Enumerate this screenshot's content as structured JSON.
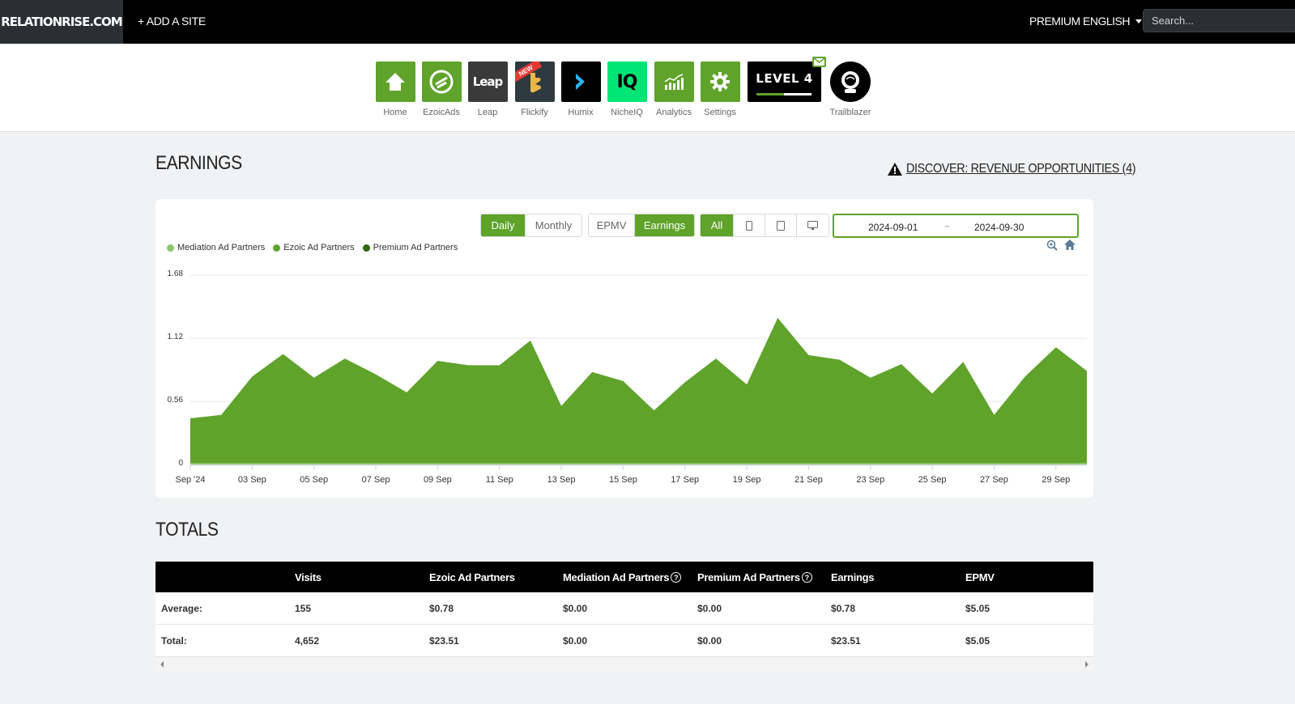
{
  "topbar": {
    "brand": "RELATIONRISE.COM",
    "add_site": "+ ADD A SITE",
    "premium": "PREMIUM",
    "language": "ENGLISH",
    "search_placeholder": "Search..."
  },
  "apps": [
    {
      "label": "Home",
      "icon": "home-icon",
      "color": "#5fa32b"
    },
    {
      "label": "EzoicAds",
      "icon": "ezoic-ads-icon",
      "color": "#5fa32b"
    },
    {
      "label": "Leap",
      "icon": "leap-icon",
      "color": "#3a3a3a",
      "tile_text": "Leap"
    },
    {
      "label": "Flickify",
      "icon": "flickify-icon",
      "color": "#2f3a40",
      "badge": "NEW"
    },
    {
      "label": "Humix",
      "icon": "humix-icon",
      "color": "#000000"
    },
    {
      "label": "NicheIQ",
      "icon": "nicheiq-icon",
      "color": "#00e676",
      "tile_text": "IQ"
    },
    {
      "label": "Analytics",
      "icon": "analytics-icon",
      "color": "#5fa32b"
    },
    {
      "label": "Settings",
      "icon": "gear-icon",
      "color": "#5fa32b"
    }
  ],
  "level": {
    "label": "LEVEL 4",
    "progress": 0.5
  },
  "trailblazer": {
    "label": "Trailblazer"
  },
  "earnings": {
    "title": "EARNINGS",
    "discover_link": "DISCOVER: REVENUE OPPORTUNITIES (4)"
  },
  "controls": {
    "period": [
      {
        "label": "Daily",
        "active": true
      },
      {
        "label": "Monthly",
        "active": false
      }
    ],
    "metric": [
      {
        "label": "EPMV",
        "active": false
      },
      {
        "label": "Earnings",
        "active": true
      }
    ],
    "device_all": "All",
    "date_start": "2024-09-01",
    "date_sep": "~",
    "date_end": "2024-09-30"
  },
  "colors": {
    "accent": "#5fa32b",
    "mediation": "#8dc26f",
    "ezoic": "#5fa32b",
    "premium": "#2e6b12"
  },
  "chart_data": {
    "type": "area",
    "series": [
      {
        "name": "Mediation Ad Partners",
        "values": [
          0,
          0,
          0,
          0,
          0,
          0,
          0,
          0,
          0,
          0,
          0,
          0,
          0,
          0,
          0,
          0,
          0,
          0,
          0,
          0,
          0,
          0,
          0,
          0,
          0,
          0,
          0,
          0,
          0,
          0
        ]
      },
      {
        "name": "Ezoic Ad Partners",
        "values": [
          0.41,
          0.44,
          0.78,
          0.98,
          0.77,
          0.94,
          0.8,
          0.64,
          0.92,
          0.88,
          0.88,
          1.1,
          0.52,
          0.82,
          0.74,
          0.48,
          0.73,
          0.94,
          0.71,
          1.3,
          0.97,
          0.93,
          0.77,
          0.89,
          0.63,
          0.91,
          0.44,
          0.78,
          1.04,
          0.83
        ]
      },
      {
        "name": "Premium Ad Partners",
        "values": [
          0,
          0,
          0,
          0,
          0,
          0,
          0,
          0,
          0,
          0,
          0,
          0,
          0,
          0,
          0,
          0,
          0,
          0,
          0,
          0,
          0,
          0,
          0,
          0,
          0,
          0,
          0,
          0,
          0,
          0
        ]
      }
    ],
    "x": [
      "2024-09-01",
      "2024-09-02",
      "2024-09-03",
      "2024-09-04",
      "2024-09-05",
      "2024-09-06",
      "2024-09-07",
      "2024-09-08",
      "2024-09-09",
      "2024-09-10",
      "2024-09-11",
      "2024-09-12",
      "2024-09-13",
      "2024-09-14",
      "2024-09-15",
      "2024-09-16",
      "2024-09-17",
      "2024-09-18",
      "2024-09-19",
      "2024-09-20",
      "2024-09-21",
      "2024-09-22",
      "2024-09-23",
      "2024-09-24",
      "2024-09-25",
      "2024-09-26",
      "2024-09-27",
      "2024-09-28",
      "2024-09-29",
      "2024-09-30"
    ],
    "x_tick_labels": [
      "Sep '24",
      "03 Sep",
      "05 Sep",
      "07 Sep",
      "09 Sep",
      "11 Sep",
      "13 Sep",
      "15 Sep",
      "17 Sep",
      "19 Sep",
      "21 Sep",
      "23 Sep",
      "25 Sep",
      "27 Sep",
      "29 Sep"
    ],
    "y_ticks": [
      "0",
      "0.56",
      "1.12",
      "1.68"
    ],
    "ylim": [
      0,
      1.68
    ],
    "grid": true,
    "legend": "top-left"
  },
  "totals": {
    "title": "TOTALS",
    "columns": [
      "",
      "Visits",
      "Ezoic Ad Partners",
      "Mediation Ad Partners",
      "Premium Ad Partners",
      "Earnings",
      "EPMV"
    ],
    "rows": [
      [
        "Average:",
        "155",
        "$0.78",
        "$0.00",
        "$0.00",
        "$0.78",
        "$5.05"
      ],
      [
        "Total:",
        "4,652",
        "$23.51",
        "$0.00",
        "$0.00",
        "$23.51",
        "$5.05"
      ]
    ]
  }
}
